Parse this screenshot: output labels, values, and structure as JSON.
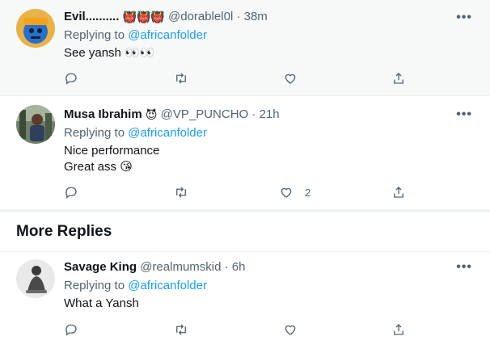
{
  "tweets": [
    {
      "name": "Evil..........",
      "badges": "👹👹👹",
      "handle": "@dorablel0l",
      "time": "38m",
      "replying_prefix": "Replying to ",
      "replying_to": "@africanfolder",
      "lines": [
        "See yansh 👀👀"
      ],
      "likes": ""
    },
    {
      "name": "Musa Ibrahim",
      "badges": "😈",
      "handle": "@VP_PUNCHO",
      "time": "21h",
      "replying_prefix": "Replying to ",
      "replying_to": "@africanfolder",
      "lines": [
        "Nice performance",
        "Great ass 😘"
      ],
      "likes": "2"
    },
    {
      "name": "Savage King",
      "badges": "",
      "handle": "@realmumskid",
      "time": "6h",
      "replying_prefix": "Replying to ",
      "replying_to": "@africanfolder",
      "lines": [
        "What a Yansh"
      ],
      "likes": ""
    }
  ],
  "section": {
    "title": "More Replies"
  },
  "separator": "·",
  "more_glyph": "•••",
  "icons": [
    "reply-icon",
    "retweet-icon",
    "like-icon",
    "share-icon",
    "more-icon"
  ],
  "colors": {
    "link": "#1d9bf0",
    "secondary": "#536471",
    "highlight_bg": "#f7f9f9"
  }
}
